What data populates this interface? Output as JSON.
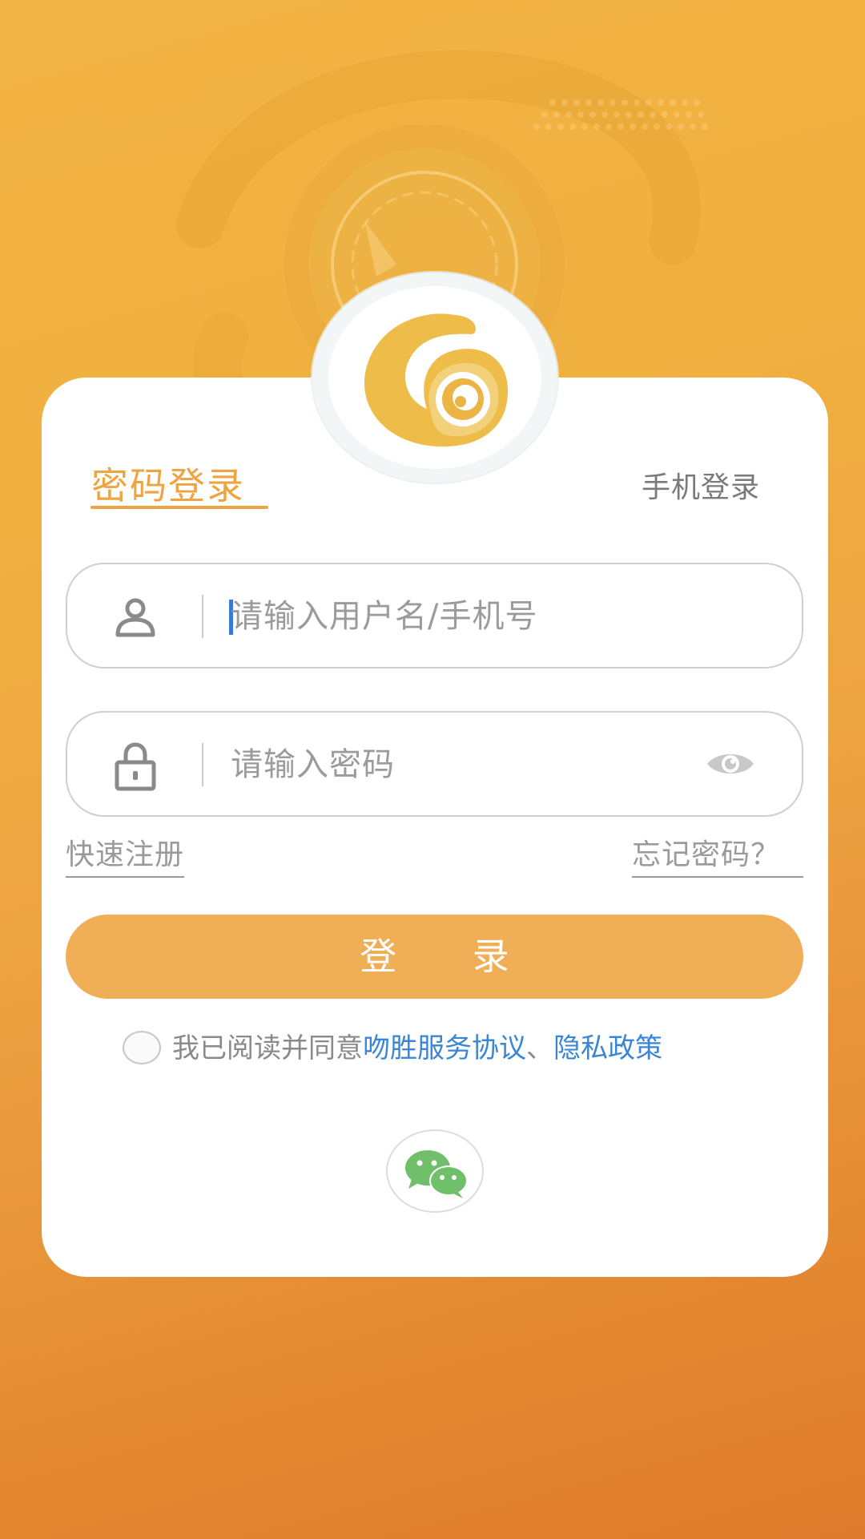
{
  "tabs": {
    "password_login": "密码登录",
    "phone_login": "手机登录"
  },
  "form": {
    "username_placeholder": "请输入用户名/手机号",
    "password_placeholder": "请输入密码"
  },
  "links": {
    "register": "快速注册",
    "forgot_password": "忘记密码？"
  },
  "login_button": "登 录",
  "agreement": {
    "prefix": "我已阅读并同意",
    "service_link": "吻胜服务协议",
    "separator": "、",
    "privacy_link": "隐私政策"
  },
  "icons": {
    "username": "user-icon",
    "password": "lock-icon",
    "toggle_visibility": "eye-icon",
    "social": "wechat-icon",
    "logo": "app-logo"
  },
  "colors": {
    "accent": "#efa443",
    "button": "#f0ae57",
    "link_blue": "#3a86d6",
    "wechat_green": "#6fbf6b"
  }
}
